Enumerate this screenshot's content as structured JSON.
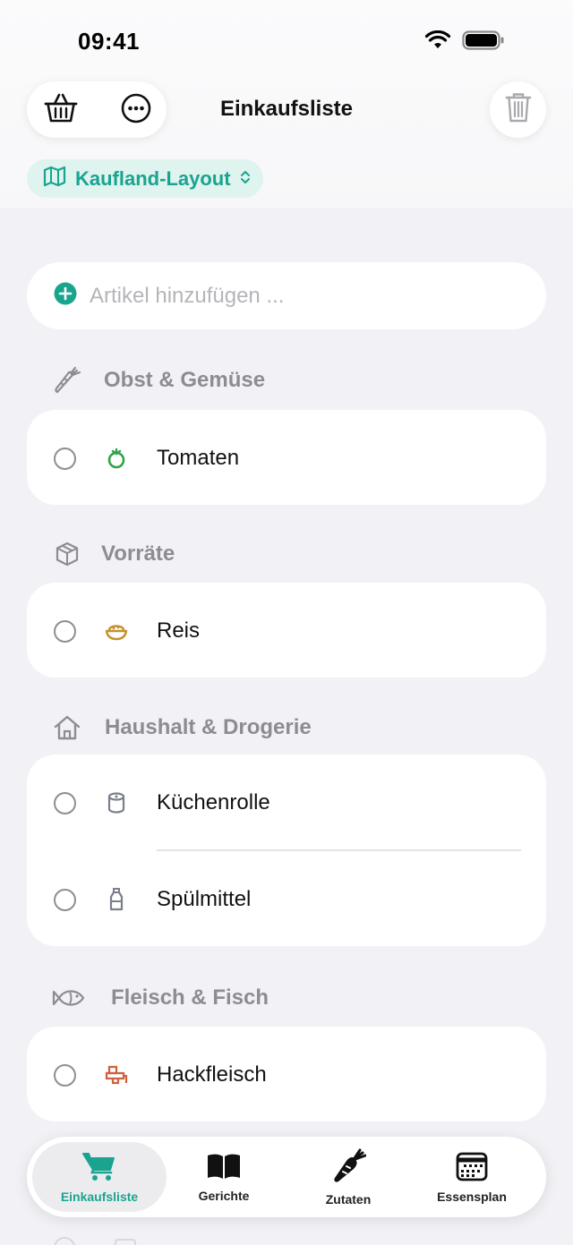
{
  "status_bar": {
    "time": "09:41"
  },
  "nav": {
    "title": "Einkaufsliste"
  },
  "layout_chip": {
    "label": "Kaufland-Layout"
  },
  "add_item": {
    "placeholder": "Artikel hinzufügen ..."
  },
  "colors": {
    "accent": "#1aa48f",
    "background": "#f2f2f6"
  },
  "sections": [
    {
      "title": "Obst & Gemüse",
      "icon": "carrot-icon",
      "items": [
        {
          "label": "Tomaten",
          "icon": "tomato-icon",
          "checked": false
        }
      ]
    },
    {
      "title": "Vorräte",
      "icon": "box-icon",
      "items": [
        {
          "label": "Reis",
          "icon": "rice-bowl-icon",
          "checked": false
        }
      ]
    },
    {
      "title": "Haushalt & Drogerie",
      "icon": "house-icon",
      "items": [
        {
          "label": "Küchenrolle",
          "icon": "paper-roll-icon",
          "checked": false
        },
        {
          "label": "Spülmittel",
          "icon": "soap-bottle-icon",
          "checked": false
        }
      ]
    },
    {
      "title": "Fleisch & Fisch",
      "icon": "fish-icon",
      "items": [
        {
          "label": "Hackfleisch",
          "icon": "meat-grinder-icon",
          "checked": false
        }
      ]
    }
  ],
  "tabs": [
    {
      "label": "Einkaufsliste",
      "icon": "cart-icon",
      "active": true
    },
    {
      "label": "Gerichte",
      "icon": "book-icon",
      "active": false
    },
    {
      "label": "Zutaten",
      "icon": "carrot-icon",
      "active": false
    },
    {
      "label": "Essensplan",
      "icon": "calendar-icon",
      "active": false
    }
  ]
}
